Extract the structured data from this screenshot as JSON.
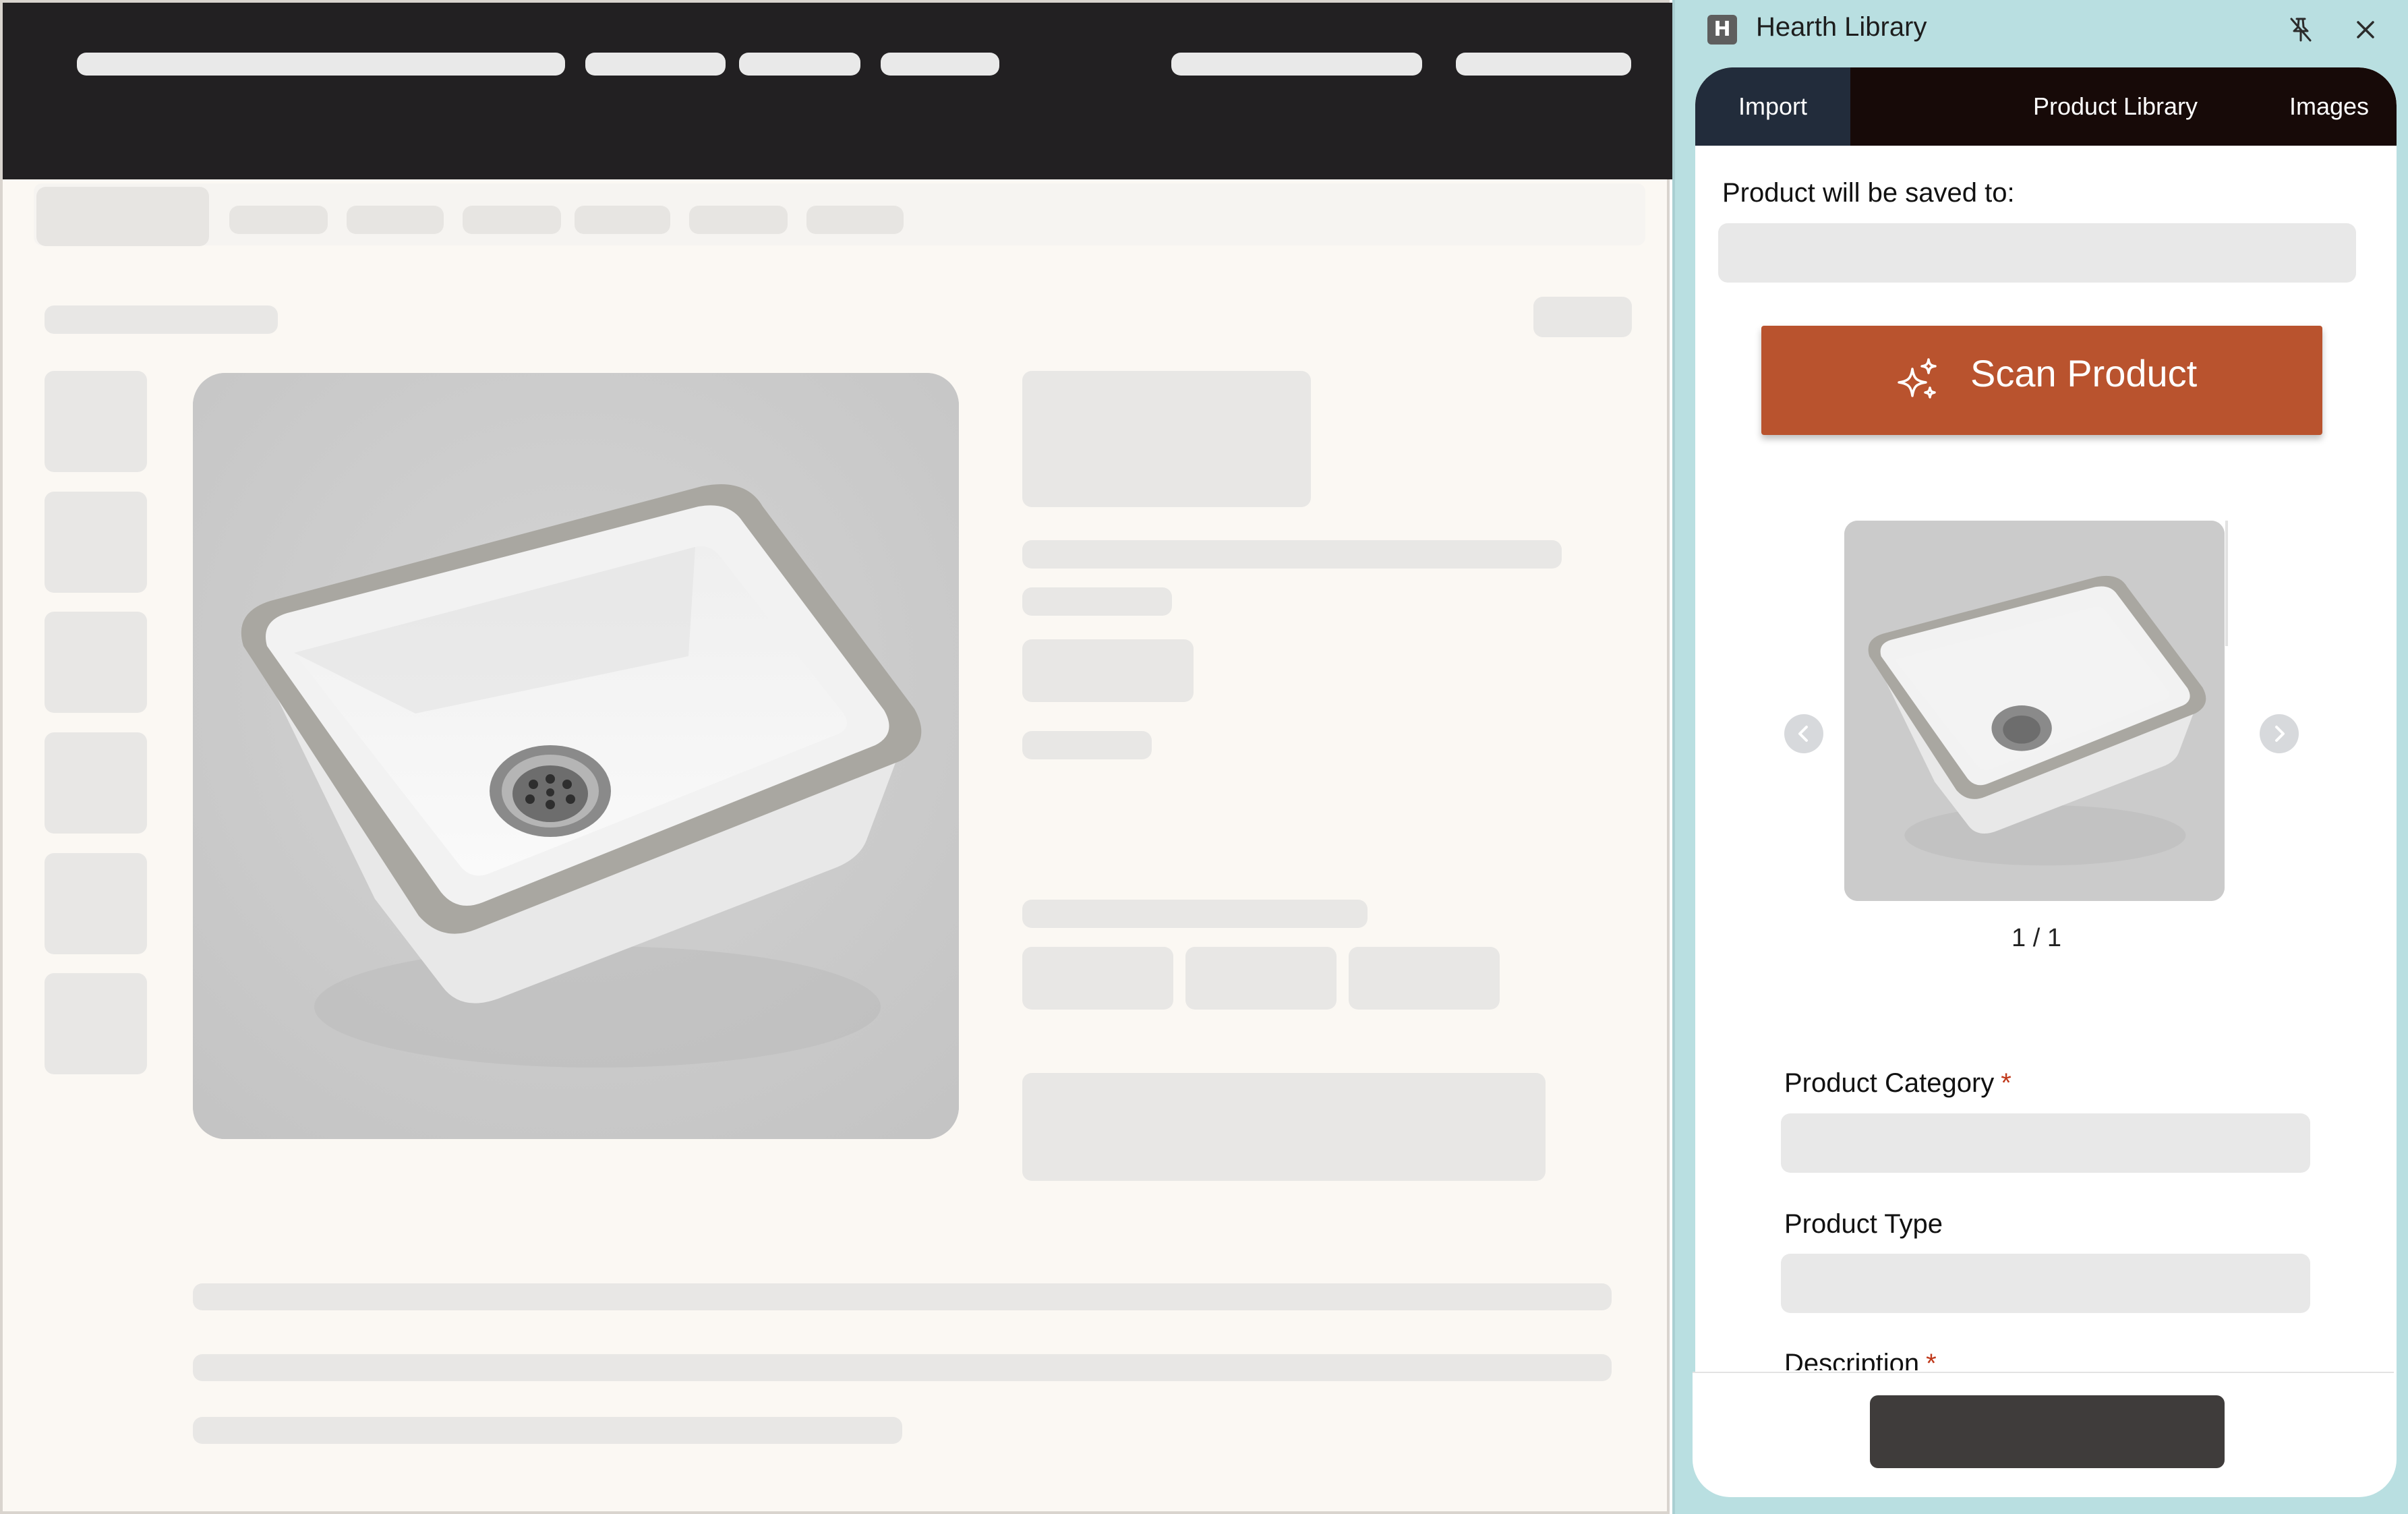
{
  "panel": {
    "logo_letter": "H",
    "app_title": "Hearth Library",
    "tabs": [
      {
        "label": "Import",
        "active": true
      },
      {
        "label": "Product Library",
        "active": false
      },
      {
        "label": "Images",
        "active": false
      }
    ],
    "save_label": "Product will be saved to:",
    "scan_button": "Scan Product",
    "image_counter": "1 / 1",
    "category_label": "Product Category",
    "type_label": "Product Type",
    "description_label": "Description",
    "required_mark": "*"
  },
  "icons": {
    "pin": "pin-off-icon",
    "close": "close-icon",
    "scan": "sparkles-icon",
    "prev": "chevron-left-icon",
    "next": "chevron-right-icon"
  },
  "colors": {
    "accent": "#b9532e",
    "tab_bar": "#170a08",
    "tab_active": "#222c3b",
    "panel_bg": "#b9dfe1",
    "required": "#c0391b"
  }
}
